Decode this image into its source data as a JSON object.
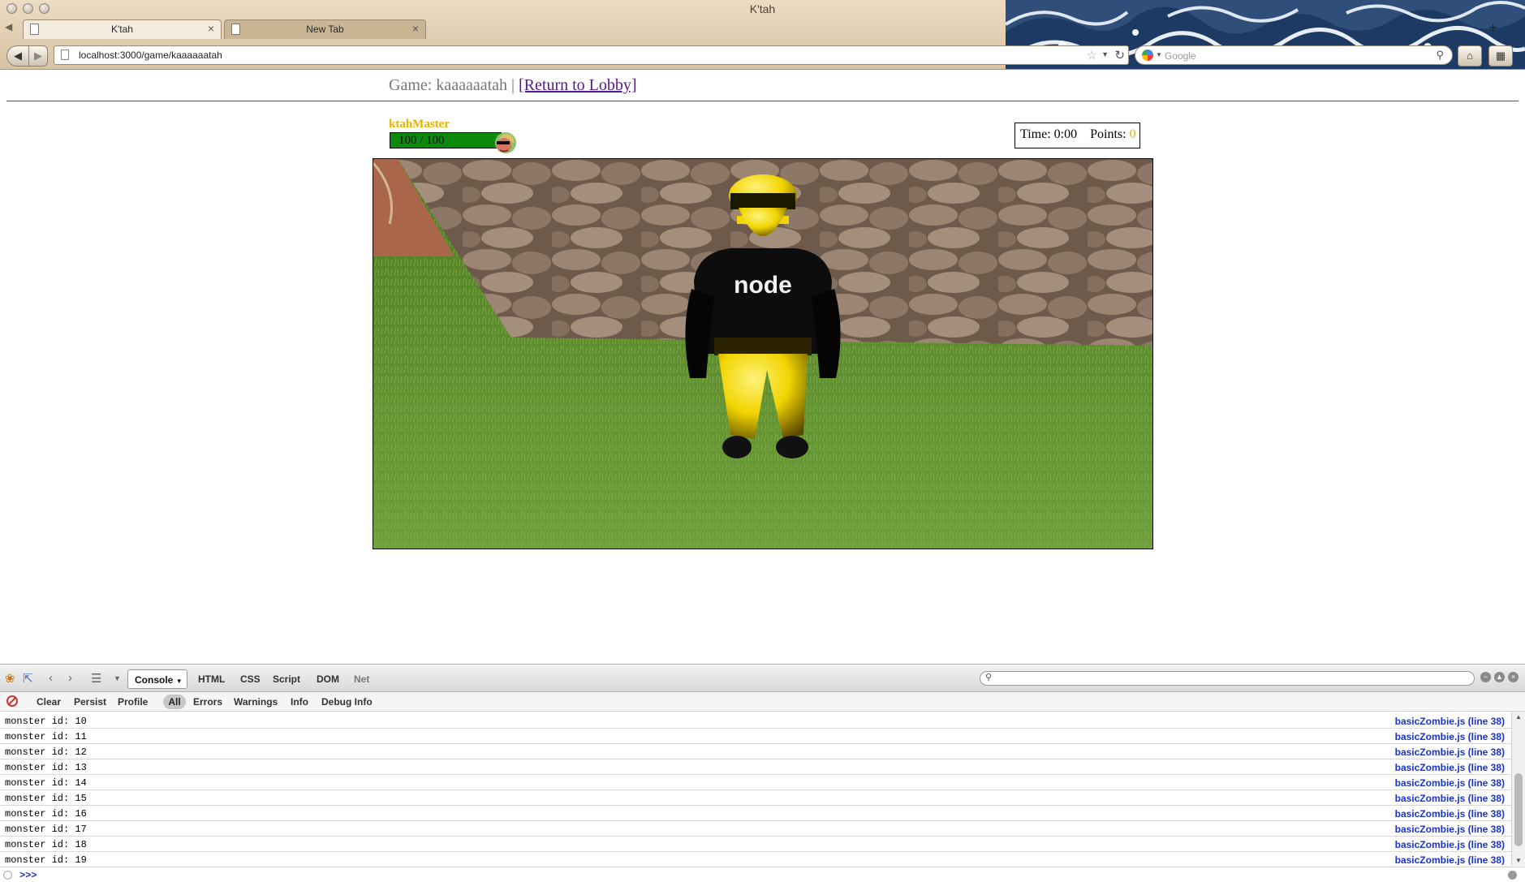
{
  "browser": {
    "window_title": "K'tah",
    "tabs": [
      {
        "label": "K'tah",
        "active": true
      },
      {
        "label": "New Tab",
        "active": false
      }
    ],
    "url": "localhost:3000/game/kaaaaaatah",
    "search_engine": "Google",
    "search_placeholder": "Google"
  },
  "page": {
    "header_prefix": "Game: kaaaaaatah |",
    "return_link": "[Return to Lobby]"
  },
  "player": {
    "name": "ktahMaster",
    "health_text": "100 / 100",
    "health_fraction": 1.0,
    "name_color": "#e3b400",
    "health_color": "#0c8a0c"
  },
  "stats": {
    "time_label": "Time: 0:00",
    "points_label": "Points:",
    "points_value": "0"
  },
  "game_scene": {
    "character_shirt_text": "node"
  },
  "firebug": {
    "main_tabs": [
      "Console",
      "HTML",
      "CSS",
      "Script",
      "DOM",
      "Net"
    ],
    "active_tab": "Console",
    "sub_actions": [
      "Clear",
      "Persist",
      "Profile"
    ],
    "filters": [
      "All",
      "Errors",
      "Warnings",
      "Info",
      "Debug Info"
    ],
    "active_filter": "All",
    "log": [
      {
        "message": "monster id: 10",
        "source": "basicZombie.js (line 38)"
      },
      {
        "message": "monster id: 11",
        "source": "basicZombie.js (line 38)"
      },
      {
        "message": "monster id: 12",
        "source": "basicZombie.js (line 38)"
      },
      {
        "message": "monster id: 13",
        "source": "basicZombie.js (line 38)"
      },
      {
        "message": "monster id: 14",
        "source": "basicZombie.js (line 38)"
      },
      {
        "message": "monster id: 15",
        "source": "basicZombie.js (line 38)"
      },
      {
        "message": "monster id: 16",
        "source": "basicZombie.js (line 38)"
      },
      {
        "message": "monster id: 17",
        "source": "basicZombie.js (line 38)"
      },
      {
        "message": "monster id: 18",
        "source": "basicZombie.js (line 38)"
      },
      {
        "message": "monster id: 19",
        "source": "basicZombie.js (line 38)"
      }
    ],
    "prompt": ">>>"
  }
}
